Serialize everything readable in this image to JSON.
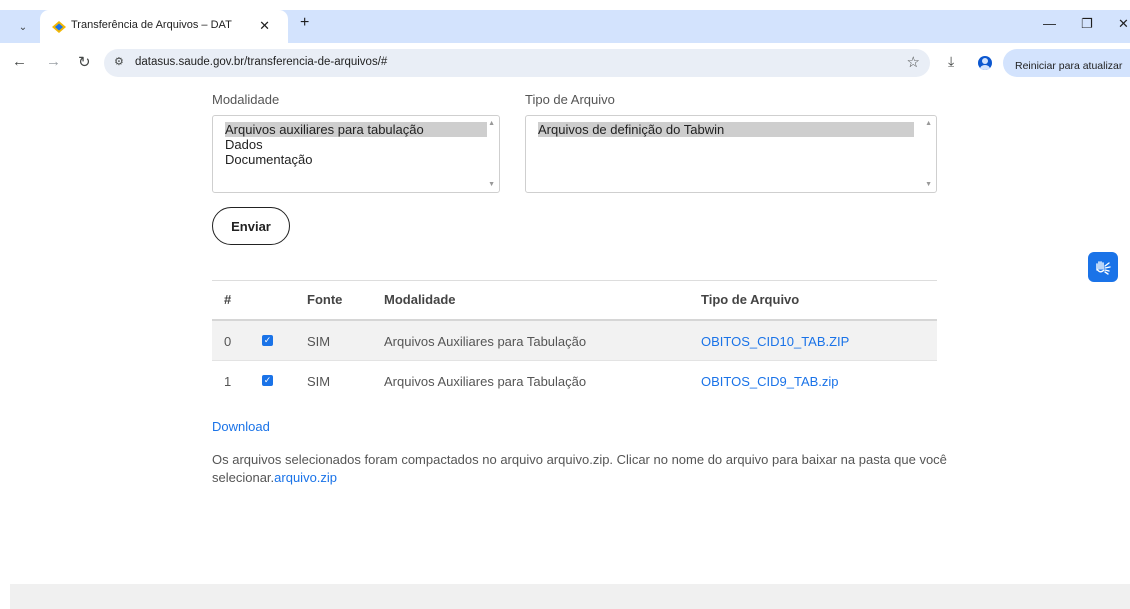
{
  "browser": {
    "tab_title": "Transferência de Arquivos – DAT",
    "tab_close": "✕",
    "new_tab": "+",
    "url": "datasus.saude.gov.br/transferencia-de-arquivos/#",
    "update_button": "Reiniciar para atualizar",
    "more_menu": "⋮",
    "icons": {
      "tab_search": "⌄",
      "back": "←",
      "forward": "→",
      "reload": "↻",
      "site_info": "⚙",
      "bookmark": "☆",
      "download": "⤓",
      "minimize": "—",
      "maximize": "❐",
      "close": "✕"
    }
  },
  "form": {
    "modalidade_label": "Modalidade",
    "modalidade_options": [
      {
        "label": "Arquivos auxiliares para tabulação",
        "selected": true
      },
      {
        "label": "Dados",
        "selected": false
      },
      {
        "label": "Documentação",
        "selected": false
      }
    ],
    "tipo_label": "Tipo de Arquivo",
    "tipo_options": [
      {
        "label": "Arquivos de definição do Tabwin",
        "selected": true
      }
    ],
    "submit_label": "Enviar"
  },
  "table": {
    "headers": [
      "#",
      "",
      "Fonte",
      "Modalidade",
      "Tipo de Arquivo"
    ],
    "rows": [
      {
        "index": "0",
        "checked": true,
        "fonte": "SIM",
        "modalidade": "Arquivos Auxiliares para Tabulação",
        "arquivo": "OBITOS_CID10_TAB.ZIP"
      },
      {
        "index": "1",
        "checked": true,
        "fonte": "SIM",
        "modalidade": "Arquivos Auxiliares para Tabulação",
        "arquivo": "OBITOS_CID9_TAB.zip"
      }
    ]
  },
  "download_label": "Download",
  "info": {
    "text": "Os arquivos selecionados foram compactados no arquivo arquivo.zip. Clicar no nome do arquivo para baixar na pasta que você selecionar.",
    "link": "arquivo.zip"
  },
  "colors": {
    "link": "#1a73e8",
    "chrome_tabbar": "#d3e3fd",
    "accessibility_widget": "#1a73e8"
  }
}
